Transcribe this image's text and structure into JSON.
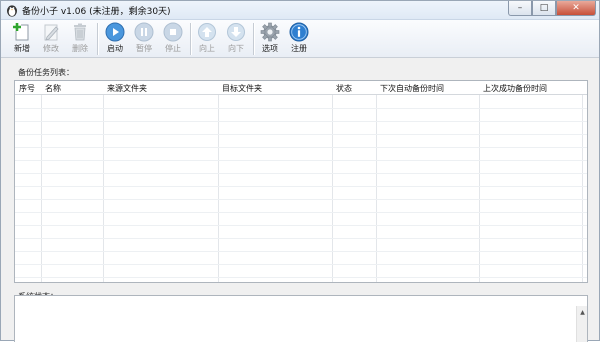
{
  "window": {
    "title": "备份小子 v1.06 (未注册，剩余30天)",
    "minimize_glyph": "–",
    "maximize_glyph": "□",
    "close_glyph": "✕"
  },
  "toolbar": {
    "new_label": "新增",
    "edit_label": "修改",
    "delete_label": "删除",
    "start_label": "启动",
    "pause_label": "暂停",
    "stop_label": "停止",
    "up_label": "向上",
    "down_label": "向下",
    "options_label": "选项",
    "register_label": "注册"
  },
  "task_list": {
    "label": "备份任务列表：",
    "columns": [
      "序号",
      "名称",
      "来源文件夹",
      "目标文件夹",
      "状态",
      "下次自动备份时间",
      "上次成功备份时间"
    ],
    "rows": []
  },
  "status": {
    "label": "系统状态：",
    "scroll_up_glyph": "▲"
  },
  "colors": {
    "accent_blue": "#2f7fd0",
    "add_green": "#2fa52f",
    "disabled_gray": "#a9b4bf"
  }
}
